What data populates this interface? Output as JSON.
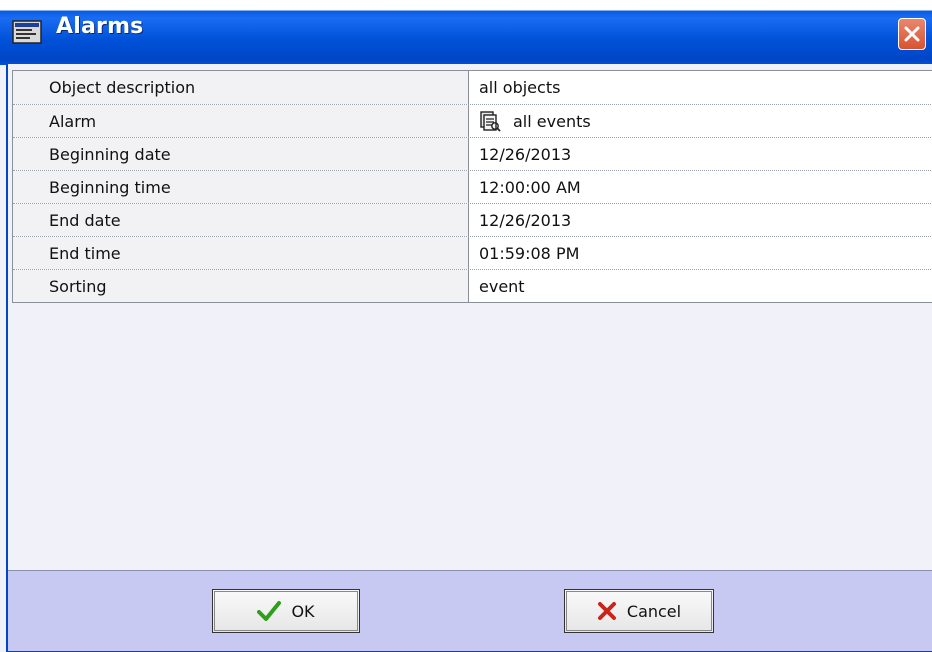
{
  "window": {
    "title": "Alarms"
  },
  "rows": [
    {
      "label": "Object description",
      "value": "all objects"
    },
    {
      "label": "Alarm",
      "value": "all events",
      "icon": "event-list-icon"
    },
    {
      "label": "Beginning date",
      "value": "12/26/2013"
    },
    {
      "label": "Beginning time",
      "value": "12:00:00 AM"
    },
    {
      "label": "End date",
      "value": "12/26/2013"
    },
    {
      "label": "End time",
      "value": "01:59:08 PM"
    },
    {
      "label": "Sorting",
      "value": "event"
    }
  ],
  "buttons": {
    "ok_label": "OK",
    "ok_icon": "checkmark-icon",
    "cancel_label": "Cancel",
    "cancel_icon": "x-icon"
  },
  "colors": {
    "titlebar": "#0051d8",
    "footer": "#c8c9f3",
    "close": "#d8532f",
    "ok_icon": "#2f9e1b",
    "cancel_icon": "#c8261a"
  }
}
